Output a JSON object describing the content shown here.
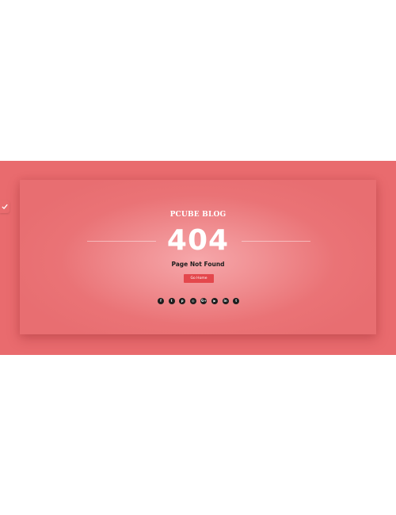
{
  "blog": {
    "name": "PCUBE BLOG"
  },
  "error": {
    "code": "404",
    "message": "Page Not Found"
  },
  "actions": {
    "home_label": "Go Home"
  },
  "social_icons": [
    {
      "name": "facebook-icon",
      "glyph": "f"
    },
    {
      "name": "twitter-icon",
      "glyph": "t"
    },
    {
      "name": "pinterest-icon",
      "glyph": "p"
    },
    {
      "name": "instagram-icon",
      "glyph": "◎"
    },
    {
      "name": "google-plus-icon",
      "glyph": "G+"
    },
    {
      "name": "youtube-icon",
      "glyph": "▶"
    },
    {
      "name": "linkedin-icon",
      "glyph": "in"
    },
    {
      "name": "tumblr-icon",
      "glyph": "t"
    }
  ],
  "colors": {
    "background_band": "#e96b6e",
    "card_center": "#f6a7aa",
    "button": "#e4474c",
    "social_circle": "#1f1f1f"
  }
}
